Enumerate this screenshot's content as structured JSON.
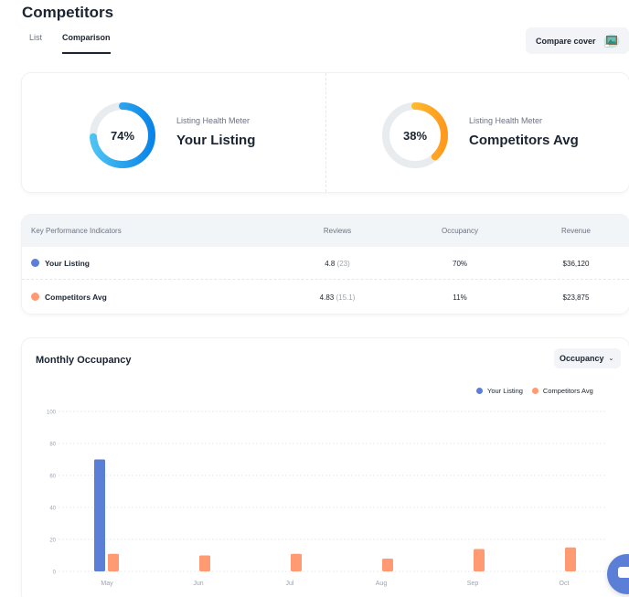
{
  "page": {
    "title": "Competitors",
    "tabs": [
      {
        "label": "List",
        "active": false
      },
      {
        "label": "Comparison",
        "active": true
      }
    ],
    "compare_button": {
      "label": "Compare cover",
      "icon": "picture-frame-icon"
    }
  },
  "health": {
    "your_listing": {
      "percent": 74,
      "percent_label": "74%",
      "caption": "Listing Health Meter",
      "name": "Your Listing",
      "colors": [
        "#4cc3f2",
        "#0a84e8"
      ]
    },
    "competitors": {
      "percent": 38,
      "percent_label": "38%",
      "caption": "Listing Health Meter",
      "name": "Competitors Avg",
      "colors": [
        "#ffd53a",
        "#ff9a1f"
      ]
    },
    "track_color": "#e9ecef"
  },
  "kpi": {
    "headers": [
      "Key Performance Indicators",
      "Reviews",
      "Occupancy",
      "Revenue"
    ],
    "rows": [
      {
        "name": "Your Listing",
        "color": "#5b7fd6",
        "rating": "4.8",
        "review_count": "(23)",
        "occupancy": "70%",
        "revenue": "$36,120"
      },
      {
        "name": "Competitors Avg",
        "color": "#ff9a73",
        "rating": "4.83",
        "review_count": "(15.1)",
        "occupancy": "11%",
        "revenue": "$23,875"
      }
    ]
  },
  "monthly": {
    "title": "Monthly Occupancy",
    "dropdown": {
      "selected": "Occupancy",
      "icon": "chevron-down-icon"
    }
  },
  "chart_data": {
    "type": "bar",
    "title": "Monthly Occupancy",
    "xlabel": "",
    "ylabel": "",
    "categories": [
      "May",
      "Jun",
      "Jul",
      "Aug",
      "Sep",
      "Oct"
    ],
    "series": [
      {
        "name": "Your Listing",
        "color": "#5b7fd6",
        "values": [
          70,
          0,
          0,
          0,
          0,
          0
        ]
      },
      {
        "name": "Competitors Avg",
        "color": "#ff9a73",
        "values": [
          11,
          10,
          11,
          8,
          14,
          15
        ]
      }
    ],
    "ylim": [
      0,
      100
    ],
    "yticks": [
      0,
      20,
      40,
      60,
      80,
      100
    ],
    "grid": true,
    "legend": "top-right"
  },
  "chat": {
    "icon": "chat-bubble-icon"
  }
}
